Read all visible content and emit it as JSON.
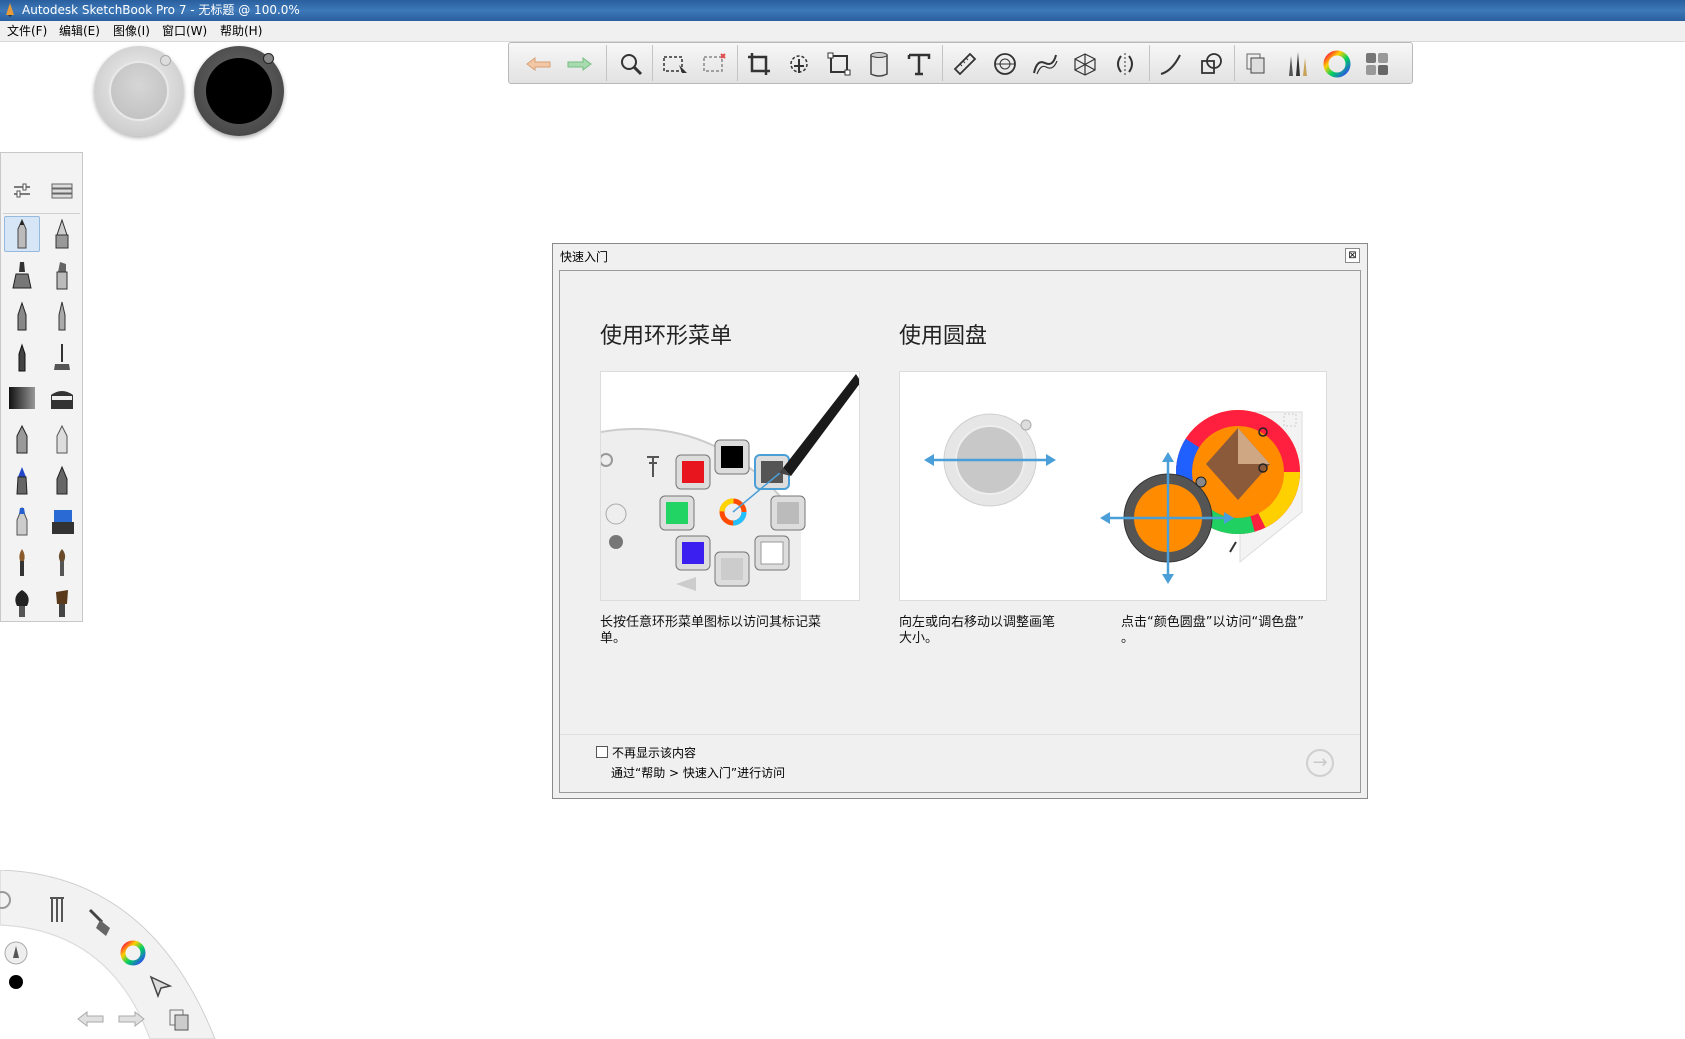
{
  "window": {
    "title": "Autodesk SketchBook Pro 7 - 无标题 @ 100.0%"
  },
  "menu": [
    "文件(F)",
    "编辑(E)",
    "图像(I)",
    "窗口(W)",
    "帮助(H)"
  ],
  "toolbar": {
    "icons": [
      "undo-icon",
      "redo-icon",
      "zoom-icon",
      "select-icon",
      "lasso-select-icon",
      "crop-icon",
      "transform-icon",
      "distort-icon",
      "fill-icon",
      "text-icon",
      "ruler-icon",
      "ellipse-guide-icon",
      "french-curve-icon",
      "perspective-icon",
      "symmetry-icon",
      "stroke-icon",
      "shape-icon",
      "layers-icon",
      "brushes-icon",
      "color-wheel-icon",
      "copic-library-icon"
    ]
  },
  "brush_palette": {
    "icons": [
      "brush-properties-icon",
      "layer-editor-icon"
    ],
    "selected": "pencil"
  },
  "dialog": {
    "title": "快速入门",
    "close_label": "⊠",
    "left_panel": {
      "heading": "使用环形菜单",
      "caption_line1": "长按任意环形菜单图标以访问其标记菜",
      "caption_line2": "单。"
    },
    "right_panel": {
      "heading": "使用圆盘",
      "caption_a_line1": "向左或向右移动以调整画笔",
      "caption_a_line2": "大小。",
      "caption_b_line1": "点击“颜色圆盘”以访问“调色盘”",
      "caption_b_line2": "。"
    },
    "dont_show_label": "不再显示该内容",
    "access_hint": "通过“帮助 > 快速入门”进行访问",
    "next_label": "→"
  },
  "colors": {
    "accent_blue": "#4a9fd8",
    "orange": "#ff8c00",
    "red": "#e8141e",
    "green": "#22d463",
    "blue": "#3a1ff0"
  }
}
